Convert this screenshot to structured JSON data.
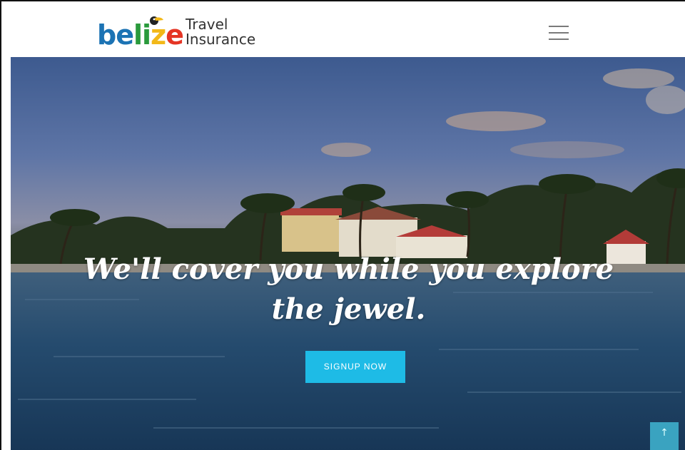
{
  "header": {
    "logo_word_parts": [
      "be",
      "li",
      "z",
      "e"
    ],
    "logo_text_line1": "Travel",
    "logo_text_line2": "Insurance",
    "menu_icon": "hamburger-menu-icon"
  },
  "hero": {
    "title": "We'll cover you while you explore the jewel.",
    "cta_label": "SIGNUP NOW"
  },
  "scroll_top": {
    "icon": "arrow-up-icon",
    "glyph": "↑"
  },
  "colors": {
    "brand_blue": "#1c73b4",
    "brand_green": "#2a9a3c",
    "brand_yellow": "#f2b818",
    "brand_red": "#e53525",
    "cta": "#1ebbe6",
    "scroll_top": "#3aa3c0"
  }
}
